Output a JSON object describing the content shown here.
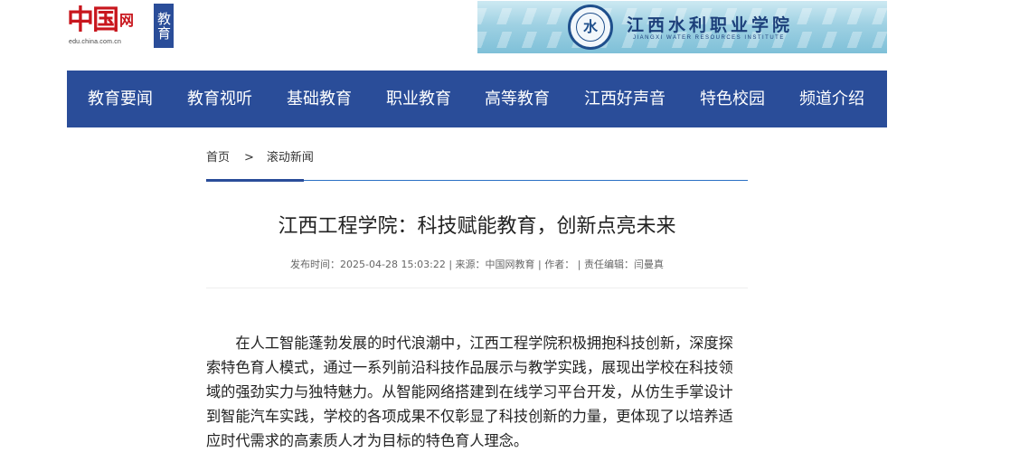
{
  "header": {
    "logo_main": "中国",
    "logo_small": "网",
    "logo_url": "edu.china.com.cn",
    "channel_badge": "教育",
    "banner": {
      "seal_text": "水",
      "school_name": "江西水利职业学院",
      "school_name_en": "JIANGXI WATER RESOURCES INSTITUTE"
    }
  },
  "nav": {
    "items": [
      {
        "label": "教育要闻"
      },
      {
        "label": "教育视听"
      },
      {
        "label": "基础教育"
      },
      {
        "label": "职业教育"
      },
      {
        "label": "高等教育"
      },
      {
        "label": "江西好声音"
      },
      {
        "label": "特色校园"
      },
      {
        "label": "频道介绍"
      }
    ]
  },
  "breadcrumb": {
    "home": "首页",
    "separator": ">",
    "current": "滚动新闻"
  },
  "article": {
    "title": "江西工程学院：科技赋能教育，创新点亮未来",
    "meta": "发布时间：2025-04-28 15:03:22 | 来源：中国网教育 | 作者：  | 责任编辑：闫曼真",
    "body": "在人工智能蓬勃发展的时代浪潮中，江西工程学院积极拥抱科技创新，深度探索特色育人模式，通过一系列前沿科技作品展示与教学实践，展现出学校在科技领域的强劲实力与独特魅力。从智能网络搭建到在线学习平台开发，从仿生手掌设计到智能汽车实践，学校的各项成果不仅彰显了科技创新的力量，更体现了以培养适应时代需求的高素质人才为目标的特色育人理念。"
  },
  "colors": {
    "nav_background": "#2a4d99",
    "logo_red": "#c8161d",
    "accent_line": "#2a70c4"
  }
}
